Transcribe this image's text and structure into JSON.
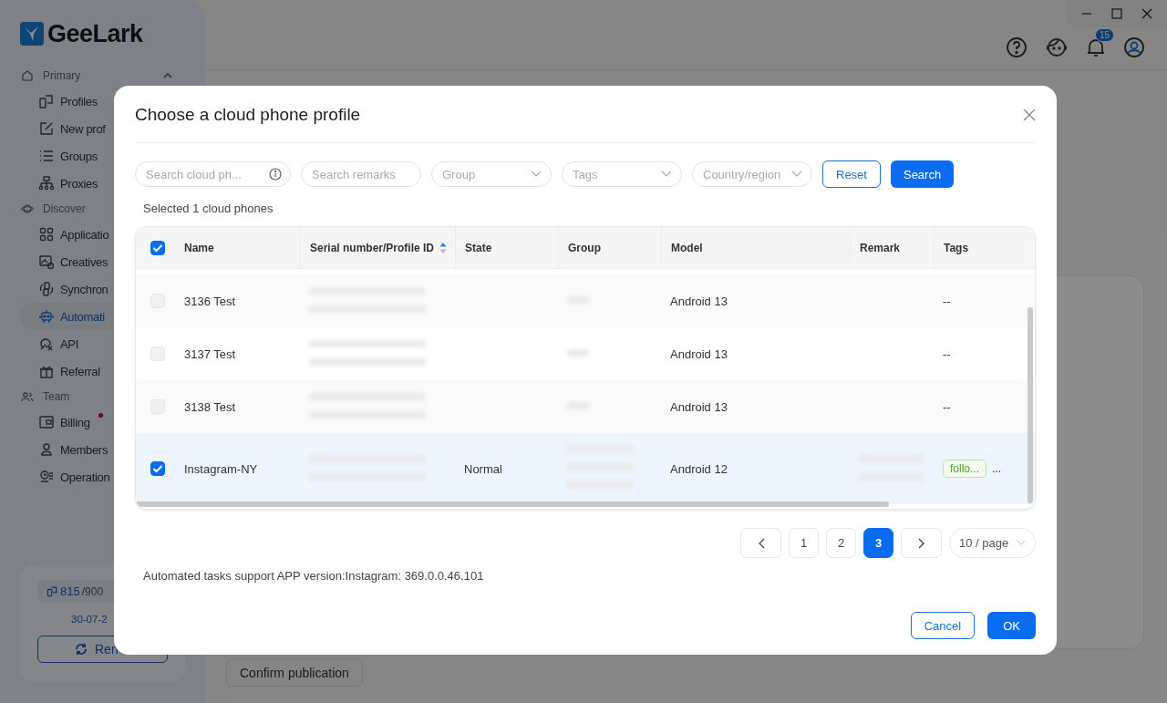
{
  "header": {
    "notification_count": "15"
  },
  "sidebar": {
    "logo": "GeeLark",
    "sections": [
      {
        "label": "Primary",
        "expanded": true,
        "items": [
          {
            "label": "Profiles",
            "selected": false,
            "unread": false
          },
          {
            "label": "New prof",
            "selected": false,
            "unread": false
          },
          {
            "label": "Groups",
            "selected": false,
            "unread": false
          },
          {
            "label": "Proxies",
            "selected": false,
            "unread": false
          }
        ]
      },
      {
        "label": "Discover",
        "items": [
          {
            "label": "Applicatio",
            "selected": false,
            "unread": false
          },
          {
            "label": "Creatives",
            "selected": false,
            "unread": false
          },
          {
            "label": "Synchron",
            "selected": false,
            "unread": false
          },
          {
            "label": "Automati",
            "selected": true,
            "unread": false
          },
          {
            "label": "API",
            "selected": false,
            "unread": false
          },
          {
            "label": "Referral",
            "selected": false,
            "unread": false
          }
        ]
      },
      {
        "label": "Team",
        "items": [
          {
            "label": "Billing",
            "selected": false,
            "unread": true
          },
          {
            "label": "Members",
            "selected": false,
            "unread": false
          },
          {
            "label": "Operation",
            "selected": false,
            "unread": false
          }
        ]
      }
    ],
    "usage": {
      "used": "815",
      "total": "/900",
      "date": "30-07-2",
      "renew": "Ren"
    }
  },
  "main": {
    "confirm_button": "Confirm publication"
  },
  "dialog": {
    "title": "Choose a cloud phone profile",
    "filters": [
      {
        "kind": "input",
        "placeholder": "Search cloud ph...",
        "info": true
      },
      {
        "kind": "input",
        "placeholder": "Search remarks",
        "info": false
      },
      {
        "kind": "select",
        "placeholder": "Group",
        "info": false
      },
      {
        "kind": "select",
        "placeholder": "Tags",
        "info": false
      },
      {
        "kind": "select",
        "placeholder": "Country/region",
        "info": false
      }
    ],
    "reset": "Reset",
    "search": "Search",
    "summary": "Selected 1 cloud phones",
    "table": {
      "all_checked": true,
      "columns": [
        {
          "label": "Name",
          "sortable": false
        },
        {
          "label": "Serial number/Profile ID",
          "sortable": true
        },
        {
          "label": "State",
          "sortable": false
        },
        {
          "label": "Group",
          "sortable": false
        },
        {
          "label": "Model",
          "sortable": false
        },
        {
          "label": "Remark",
          "sortable": false
        },
        {
          "label": "Tags",
          "sortable": false
        }
      ],
      "rows": [
        {
          "checked": false,
          "disabled": true,
          "name": "3136 Test",
          "model": "Android 13",
          "empty": "--"
        },
        {
          "checked": false,
          "disabled": true,
          "name": "3137 Test",
          "model": "Android 13",
          "empty": "--"
        },
        {
          "checked": false,
          "disabled": true,
          "name": "3138 Test",
          "model": "Android 13",
          "empty": "--"
        },
        {
          "checked": true,
          "disabled": false,
          "name": "Instagram-NY",
          "state": "Normal",
          "model": "Android 12",
          "tags": [
            "follo..."
          ],
          "more": "..."
        }
      ]
    },
    "pagination": {
      "pages": [
        {
          "label": "1",
          "selected": false
        },
        {
          "label": "2",
          "selected": false
        },
        {
          "label": "3",
          "selected": true
        }
      ],
      "page_size": "10 / page"
    },
    "note": "Automated tasks support APP version:Instagram: 369.0.0.46.101",
    "cancel": "Cancel",
    "ok": "OK"
  }
}
